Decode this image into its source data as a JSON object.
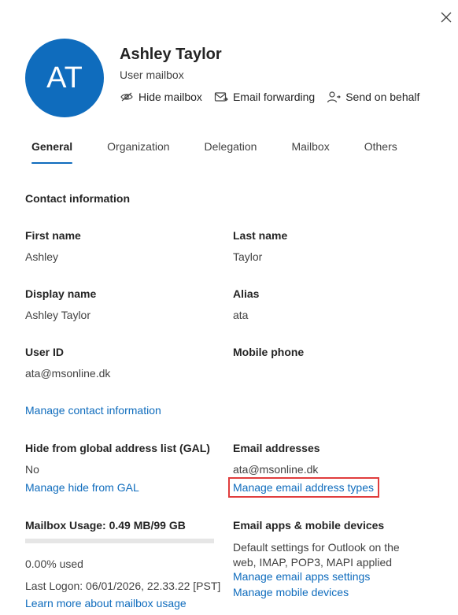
{
  "user": {
    "initials": "AT",
    "name": "Ashley Taylor",
    "type": "User mailbox",
    "avatar_color": "#0f6cbd"
  },
  "actions": [
    {
      "label": "Hide mailbox",
      "icon": "hide-icon"
    },
    {
      "label": "Email forwarding",
      "icon": "mail-forward-icon"
    },
    {
      "label": "Send on behalf",
      "icon": "person-send-icon"
    }
  ],
  "tabs": [
    {
      "label": "General",
      "active": true
    },
    {
      "label": "Organization",
      "active": false
    },
    {
      "label": "Delegation",
      "active": false
    },
    {
      "label": "Mailbox",
      "active": false
    },
    {
      "label": "Others",
      "active": false
    }
  ],
  "contact": {
    "title": "Contact information",
    "first_name_label": "First name",
    "first_name": "Ashley",
    "last_name_label": "Last name",
    "last_name": "Taylor",
    "display_name_label": "Display name",
    "display_name": "Ashley Taylor",
    "alias_label": "Alias",
    "alias": "ata",
    "user_id_label": "User ID",
    "user_id": "ata@msonline.dk",
    "mobile_label": "Mobile phone",
    "manage_link": "Manage contact information"
  },
  "gal": {
    "label": "Hide from global address list (GAL)",
    "value": "No",
    "manage_link": "Manage hide from GAL"
  },
  "email": {
    "label": "Email addresses",
    "value": "ata@msonline.dk",
    "manage_link": "Manage email address types"
  },
  "usage": {
    "label": "Mailbox Usage: 0.49 MB/99 GB",
    "percent_text": "0.00% used",
    "percent_fraction": 0.0,
    "last_logon": "Last Logon: 06/01/2026, 22.33.22 [PST]",
    "learn_link": "Learn more about mailbox usage"
  },
  "apps": {
    "label": "Email apps & mobile devices",
    "desc": "Default settings for Outlook on the web, IMAP, POP3, MAPI applied",
    "manage_apps_link": "Manage email apps settings",
    "manage_devices_link": "Manage mobile devices"
  }
}
